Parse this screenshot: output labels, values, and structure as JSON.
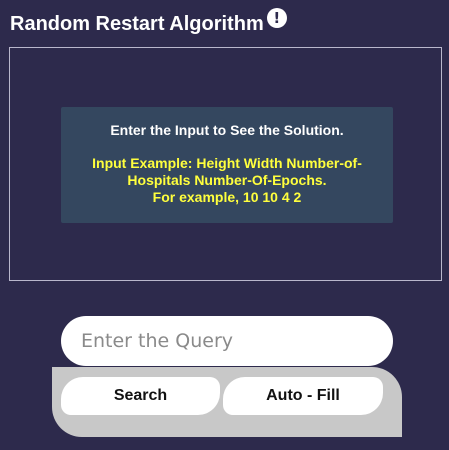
{
  "header": {
    "title": "Random Restart Algorithm",
    "info_icon": "!"
  },
  "output": {
    "prompt": "Enter the Input to See the Solution.",
    "example_line1": "Input Example: Height Width Number-of-",
    "example_line2": "Hospitals Number-Of-Epochs.",
    "example_line3": "For example, 10 10 4 2"
  },
  "query": {
    "placeholder": "Enter the Query",
    "value": ""
  },
  "buttons": {
    "search_label": "Search",
    "autofill_label": "Auto - Fill"
  },
  "colors": {
    "background": "#2d2a4c",
    "message_box": "#34475f",
    "example_text": "#ffff3d",
    "button_tray": "#c8c8c8"
  }
}
